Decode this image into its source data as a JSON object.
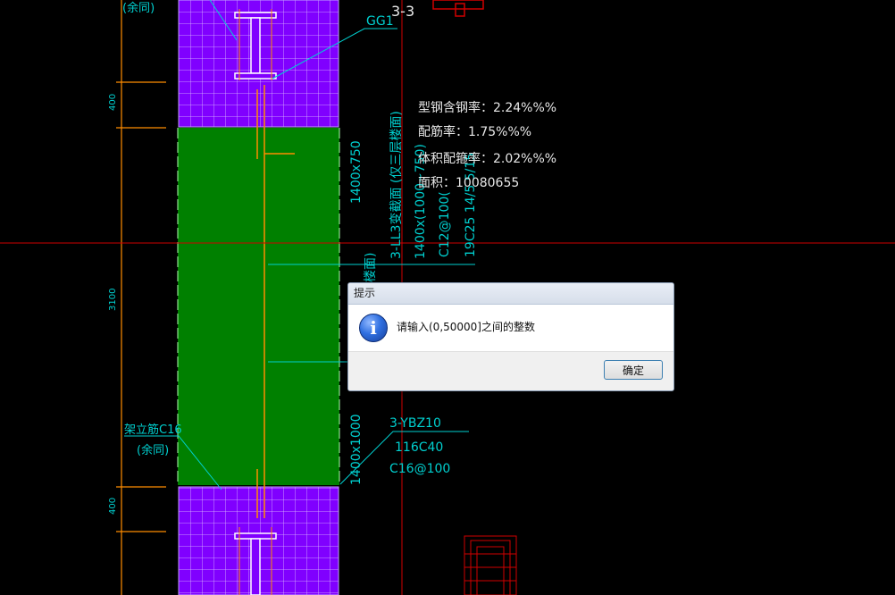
{
  "drawing": {
    "section_label": "3-3",
    "gg1_label": "GG1",
    "yuton_top": "(余同)",
    "dim_400_top": "400",
    "dim_3100": "3100",
    "dim_400_bottom": "400",
    "beam_size_1": "1400x750",
    "beam_title": "3-LL3变截面 (仅三层楼面)",
    "beam_size_2": "1400x(1000~750)",
    "beam_stirrup": "C12@100(",
    "beam_main_bars": "19C25 14/5 5/15",
    "floor_label": "层楼面)",
    "stats_steel_ratio": "型钢含钢率：2.24%%%",
    "stats_rebar_ratio": "配筋率：1.75%%%",
    "stats_volume_ratio": "体积配箍率：2.02%%%",
    "stats_area": "面积：10080655",
    "column_size": "1400x1000",
    "ybz_label": "3-YBZ10",
    "ybz_bars": "116C40",
    "ybz_stirrup": "C16@100",
    "erect_bar_label": "架立筋C16",
    "yuton_bottom": "(余同)"
  },
  "dialog": {
    "title": "提示",
    "message": "请输入(0,50000]之间的整数",
    "ok_label": "确定",
    "icon": "info-icon"
  },
  "colors": {
    "background": "#000000",
    "column_fill": "#8000ff",
    "wall_fill": "#008000",
    "annotation": "#00d0d0",
    "dimension": "#ff8c00",
    "crosshair": "#d00000",
    "stats_text": "#e8e8e8"
  }
}
